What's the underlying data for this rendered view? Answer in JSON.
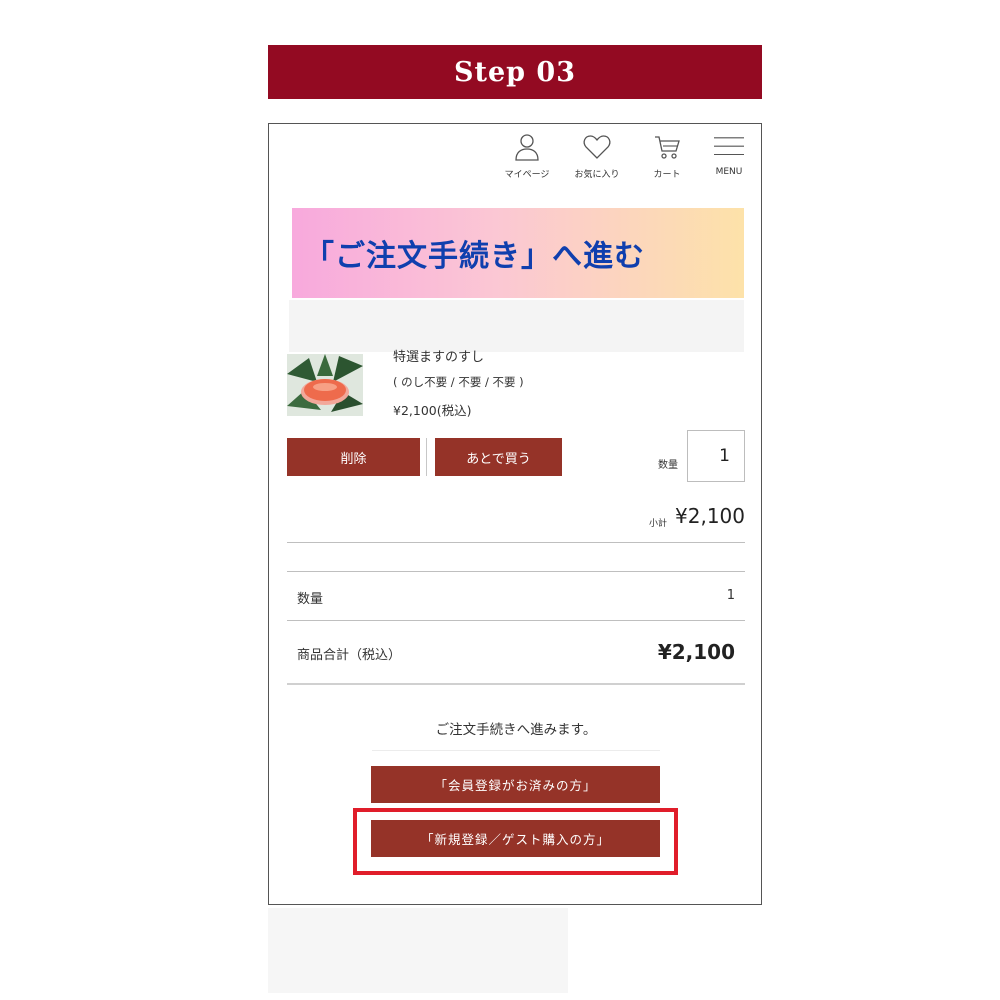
{
  "banner": {
    "title": "Step 03"
  },
  "header": {
    "mypage_label": "マイページ",
    "favorites_label": "お気に入り",
    "cart_label": "カート",
    "menu_label": "MENU"
  },
  "callout": {
    "text": "「ご注文手続き」へ進む"
  },
  "cart_item": {
    "name": "特選ますのすし",
    "options": "( のし不要 / 不要 / 不要 )",
    "price": "¥2,100(税込)",
    "delete_label": "削除",
    "later_label": "あとで買う",
    "qty_label": "数量",
    "qty_value": "1",
    "subtotal_label": "小計",
    "subtotal_value": "¥2,100"
  },
  "summary": {
    "qty_label": "数量",
    "qty_value": "1",
    "total_label": "商品合計（税込）",
    "total_value": "¥2,100"
  },
  "checkout": {
    "proceed_text": "ご注文手続きへ進みます。",
    "member_button": "「会員登録がお済みの方」",
    "guest_button": "「新規登録／ゲスト購入の方」"
  },
  "colors": {
    "banner": "#930a22",
    "button": "#953328",
    "callout_text": "#0f3fae",
    "highlight": "#e01d2a"
  },
  "icons": [
    "person-icon",
    "heart-icon",
    "cart-icon",
    "hamburger-icon"
  ]
}
